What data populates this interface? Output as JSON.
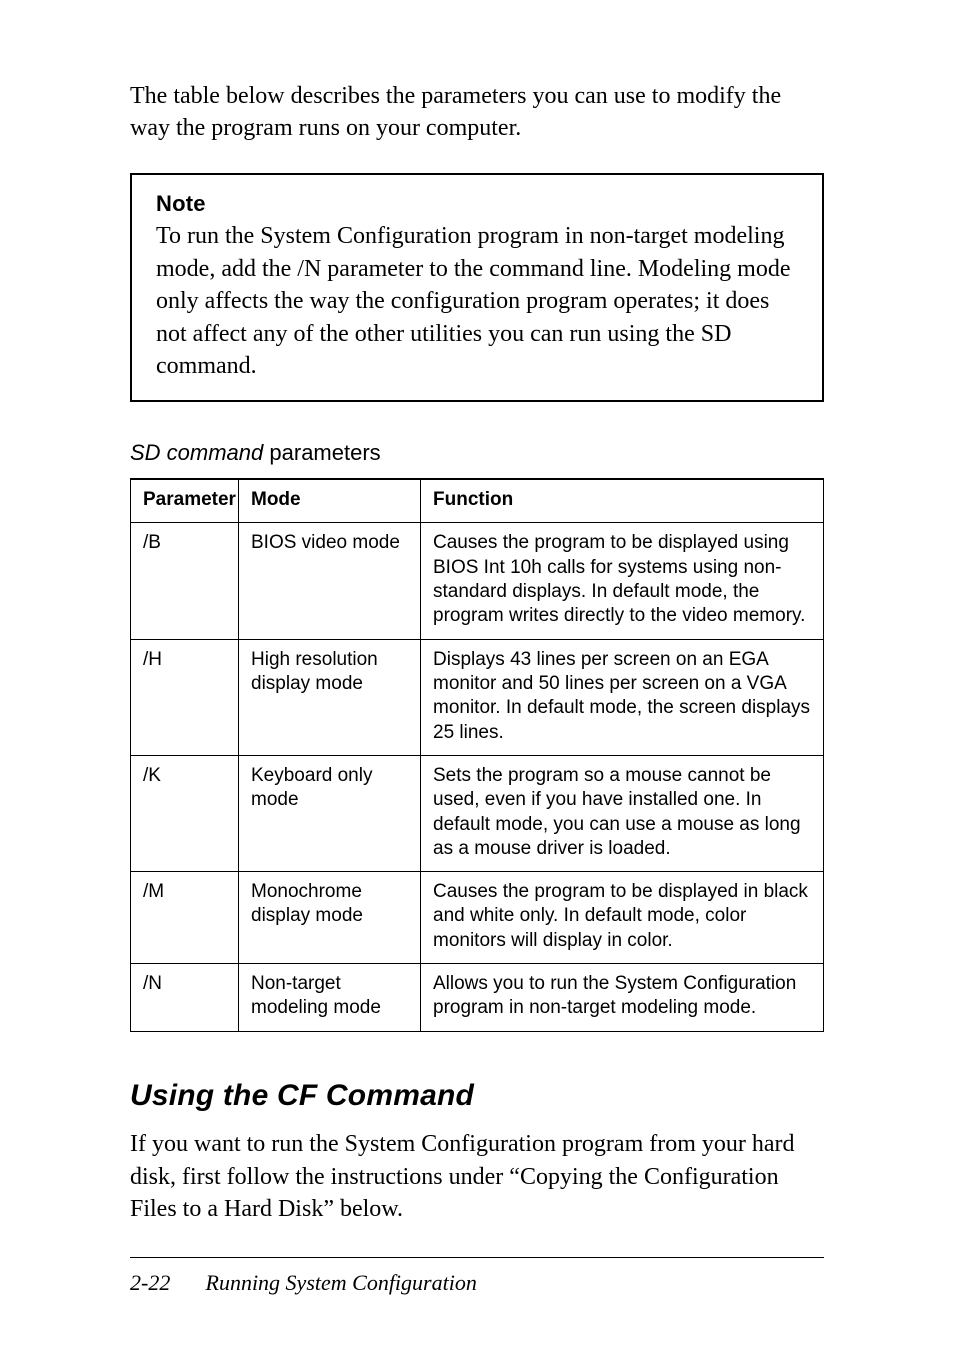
{
  "intro": "The table below describes the parameters you can use to modify the way the program runs on your computer.",
  "note": {
    "title": "Note",
    "body": "To run the System Configuration program in non-target modeling mode, add the /N parameter to the command line. Modeling mode only affects the way the configuration program operates; it does not affect any of the other utilities you can run using the SD command."
  },
  "caption": {
    "italic": "SD command",
    "rest": " parameters"
  },
  "table": {
    "headers": {
      "param": "Parameter",
      "mode": "Mode",
      "func": "Function"
    },
    "rows": [
      {
        "param": "/B",
        "mode": "BIOS video mode",
        "func": "Causes the program to be displayed using BIOS Int 10h calls for systems using non-standard displays. In default mode, the program writes directly to the video memory."
      },
      {
        "param": "/H",
        "mode": "High resolution display mode",
        "func": "Displays 43 lines per screen on an EGA monitor and 50 lines per screen on a VGA monitor. In default mode, the screen displays 25 lines."
      },
      {
        "param": "/K",
        "mode": "Keyboard only mode",
        "func": "Sets the program so a mouse cannot be used, even if you have installed one. In default mode, you can use a mouse as long as a mouse driver is loaded."
      },
      {
        "param": "/M",
        "mode": "Monochrome display mode",
        "func": "Causes the program to be displayed in black and white only. In default mode, color monitors will display in color."
      },
      {
        "param": "/N",
        "mode": "Non-target modeling mode",
        "func": "Allows you to run the System Configuration program in non-target modeling mode."
      }
    ]
  },
  "section_heading": "Using the CF Command",
  "section_body": "If you want to run the System Configuration program from your hard disk, first follow the instructions under “Copying the Configuration Files to a Hard Disk” below.",
  "footer": {
    "page": "2-22",
    "title": "Running System Configuration"
  }
}
